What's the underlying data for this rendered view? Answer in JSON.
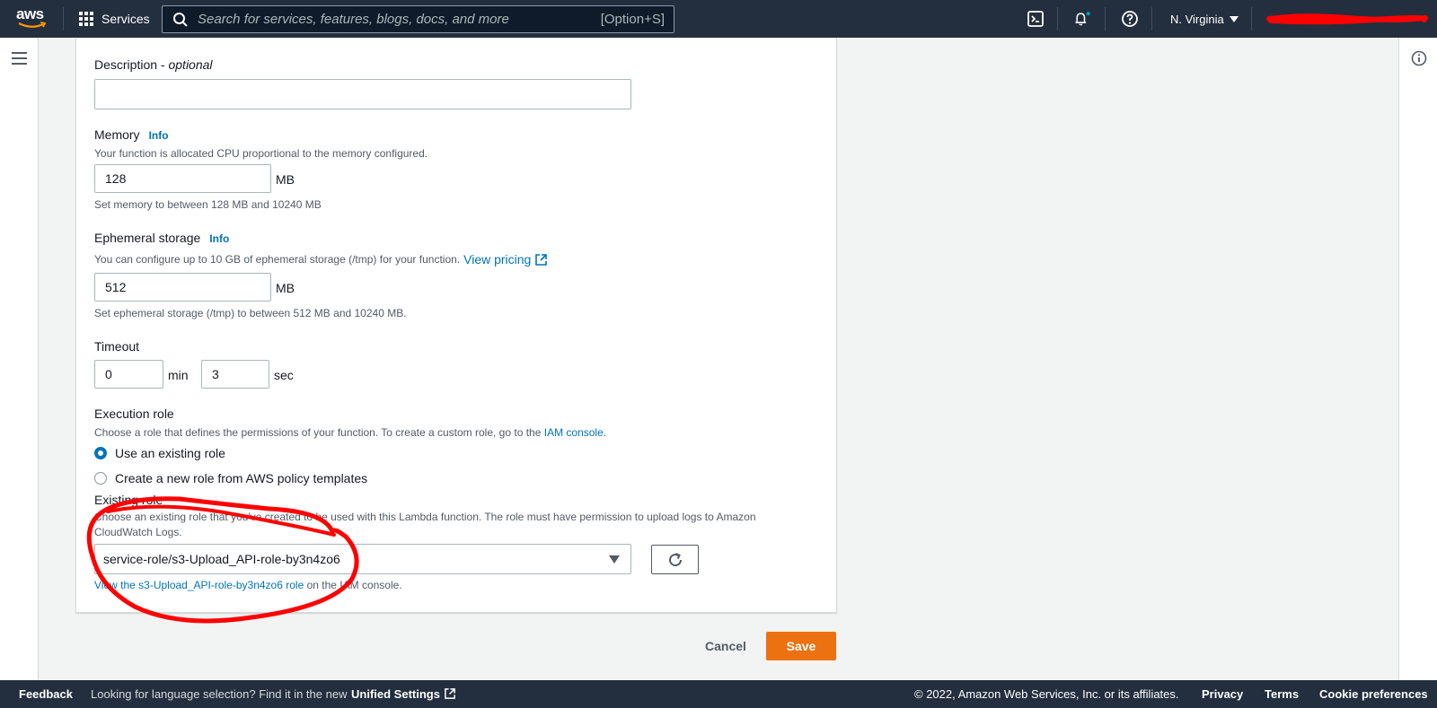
{
  "topnav": {
    "logo_text": "aws",
    "services_label": "Services",
    "search_placeholder": "Search for services, features, blogs, docs, and more",
    "search_shortcut": "[Option+S]",
    "region_label": "N. Virginia"
  },
  "form": {
    "description": {
      "label": "Description",
      "label_suffix": "optional",
      "value": ""
    },
    "memory": {
      "label": "Memory",
      "info": "Info",
      "help": "Your function is allocated CPU proportional to the memory configured.",
      "value": "128",
      "unit": "MB",
      "constraint": "Set memory to between 128 MB and 10240 MB"
    },
    "ephemeral": {
      "label": "Ephemeral storage",
      "info": "Info",
      "help": "You can configure up to 10 GB of ephemeral storage (/tmp) for your function.",
      "pricing_link": "View pricing",
      "value": "512",
      "unit": "MB",
      "constraint": "Set ephemeral storage (/tmp) to between 512 MB and 10240 MB."
    },
    "timeout": {
      "label": "Timeout",
      "min_value": "0",
      "min_unit": "min",
      "sec_value": "3",
      "sec_unit": "sec"
    },
    "execution_role": {
      "label": "Execution role",
      "help_prefix": "Choose a role that defines the permissions of your function. To create a custom role, go to the",
      "help_link": "IAM console",
      "help_suffix": ".",
      "options": [
        {
          "label": "Use an existing role",
          "selected": true
        },
        {
          "label": "Create a new role from AWS policy templates",
          "selected": false
        }
      ]
    },
    "existing_role": {
      "label": "Existing role",
      "help_line1": "Choose an existing role that you've created to be used with this Lambda function. The role must have permission to upload logs to Amazon",
      "help_line2": "CloudWatch Logs.",
      "selected": "service-role/s3-Upload_API-role-by3n4zo6",
      "view_link": "View the s3-Upload_API-role-by3n4zo6 role",
      "view_suffix": "on the IAM console."
    }
  },
  "actions": {
    "cancel": "Cancel",
    "save": "Save"
  },
  "footer": {
    "feedback": "Feedback",
    "language_prompt": "Looking for language selection? Find it in the new",
    "unified_settings": "Unified Settings",
    "copyright": "© 2022, Amazon Web Services, Inc. or its affiliates.",
    "privacy": "Privacy",
    "terms": "Terms",
    "cookie": "Cookie preferences"
  },
  "colors": {
    "nav_bg": "#232f3e",
    "accent_blue": "#0073bb",
    "save_orange": "#ec7211",
    "annotation_red": "#ff0000"
  }
}
